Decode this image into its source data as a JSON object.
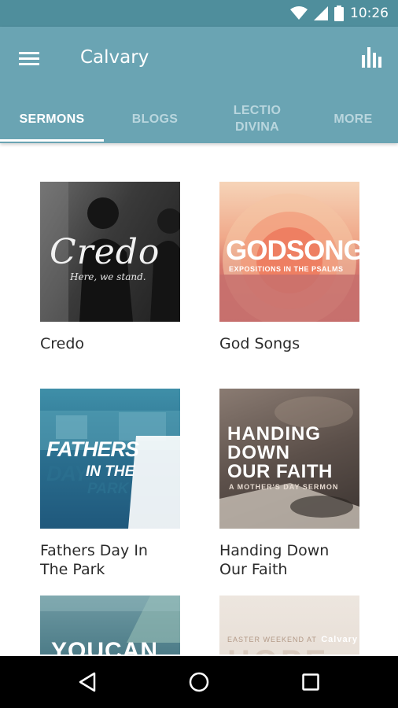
{
  "status_bar": {
    "time": "10:26"
  },
  "app_bar": {
    "title": "Calvary"
  },
  "tabs": [
    {
      "label": "SERMONS",
      "active": true
    },
    {
      "label": "BLOGS",
      "active": false
    },
    {
      "label": "LECTIO DIVINA",
      "active": false
    },
    {
      "label": "MORE",
      "active": false
    }
  ],
  "series": [
    {
      "title": "Credo",
      "art": {
        "script": "Credo",
        "sub": "Here, we stand."
      }
    },
    {
      "title": "God Songs",
      "art": {
        "big": "GODSONGS",
        "sub": "EXPOSITIONS IN THE PSALMS"
      }
    },
    {
      "title": "Fathers Day In The Park",
      "art": {
        "line1a": "FATHERS",
        "line1b": "DAY",
        "line2a": "IN THE",
        "line2b": "PARK"
      }
    },
    {
      "title": "Handing Down Our Faith",
      "art": {
        "l1": "HANDING",
        "l2": "DOWN",
        "l3": "OUR FAITH",
        "sub": "A MOTHER'S DAY SERMON"
      }
    },
    {
      "title": "",
      "art": {
        "big": "YOUCAN"
      }
    },
    {
      "title": "",
      "art": {
        "top": "EASTER WEEKEND AT",
        "brand": "Calvary",
        "big": "HOPE"
      }
    }
  ],
  "colors": {
    "status": "#4f8e9c",
    "app_bar": "#6aa4b3",
    "tab_inactive": "#b9d6de"
  }
}
